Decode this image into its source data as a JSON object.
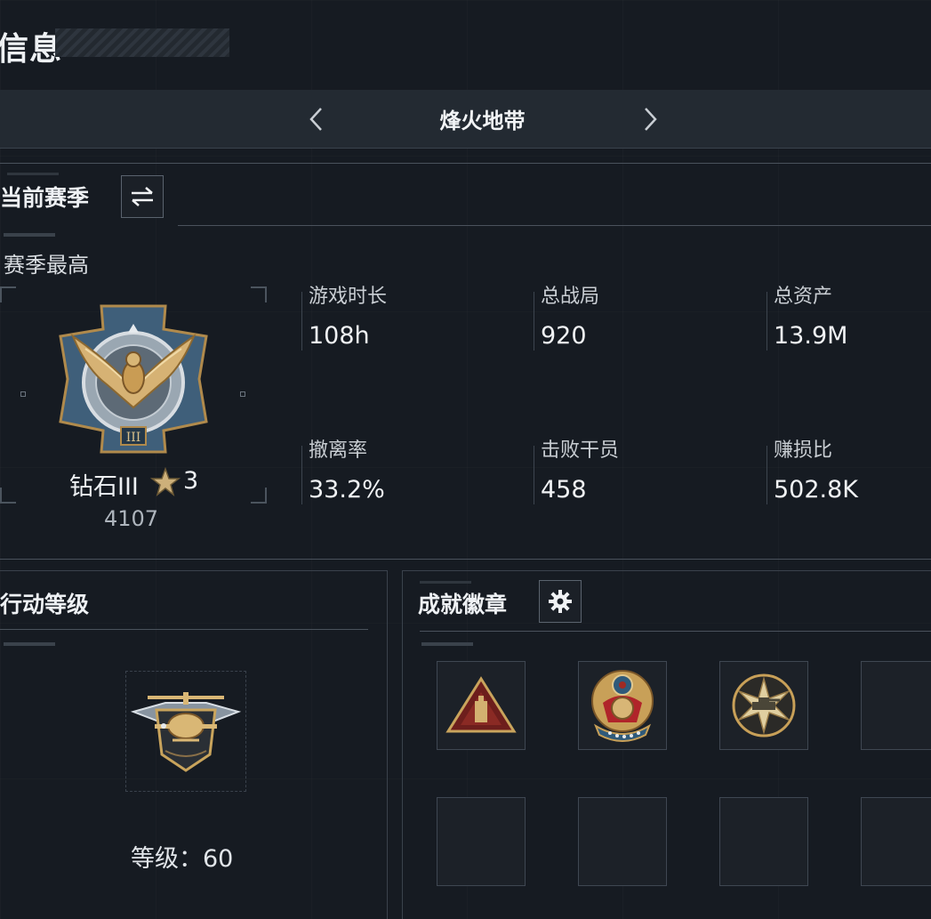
{
  "page": {
    "title": "信息"
  },
  "mode_selector": {
    "title": "烽火地带",
    "prev_icon": "chevron-left-icon",
    "next_icon": "chevron-right-icon"
  },
  "season": {
    "title": "当前赛季",
    "switch_icon": "swap-arrows-icon",
    "best_label": "赛季最高",
    "rank": {
      "name": "钻石III",
      "stars": "3",
      "score": "4107",
      "numeral": "III"
    },
    "stats": [
      {
        "label": "游戏时长",
        "value": "108h"
      },
      {
        "label": "总战局",
        "value": "920"
      },
      {
        "label": "总资产",
        "value": "13.9M"
      },
      {
        "label": "撤离率",
        "value": "33.2%"
      },
      {
        "label": "击败干员",
        "value": "458"
      },
      {
        "label": "赚损比",
        "value": "502.8K"
      }
    ]
  },
  "operation_level": {
    "title": "行动等级",
    "level_text": "等级：60"
  },
  "achievements": {
    "title": "成就徽章",
    "settings_icon": "gear-icon",
    "badges": [
      "triangle-badge",
      "skull-emblem-badge",
      "tank-star-badge",
      "empty",
      "empty",
      "empty",
      "empty",
      "empty"
    ]
  },
  "colors": {
    "background": "#161b22",
    "bar": "#232a32",
    "gold": "#c9a45c",
    "steel": "#7d93a8"
  }
}
